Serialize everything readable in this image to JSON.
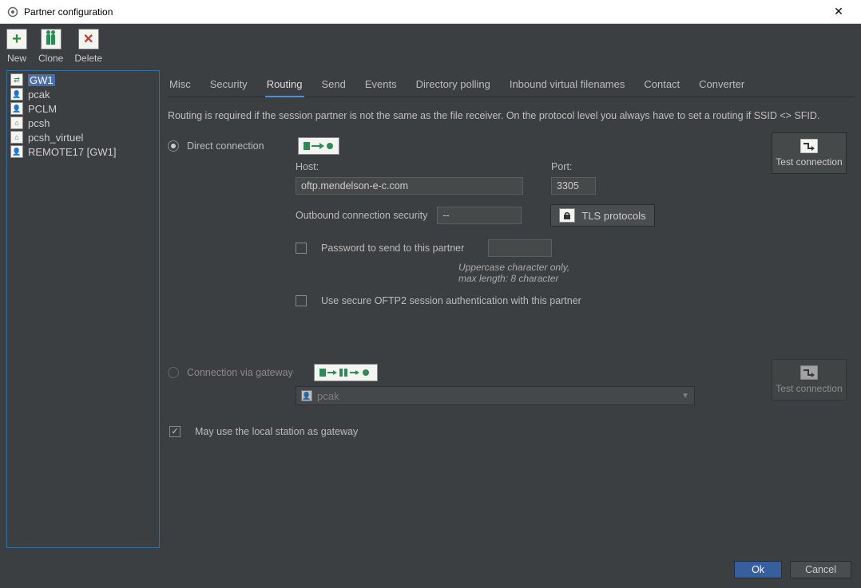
{
  "window": {
    "title": "Partner configuration"
  },
  "toolbar": {
    "new": "New",
    "clone": "Clone",
    "delete": "Delete"
  },
  "sidebar": {
    "items": [
      {
        "label": "GW1",
        "selected": true
      },
      {
        "label": "pcak"
      },
      {
        "label": "PCLM"
      },
      {
        "label": "pcsh"
      },
      {
        "label": "pcsh_virtuel"
      },
      {
        "label": "REMOTE17 [GW1]"
      }
    ]
  },
  "tabs": {
    "misc": "Misc",
    "security": "Security",
    "routing": "Routing",
    "send": "Send",
    "events": "Events",
    "dirpoll": "Directory polling",
    "inbound": "Inbound virtual filenames",
    "contact": "Contact",
    "converter": "Converter",
    "active": "routing"
  },
  "routing": {
    "info": "Routing is required if the session partner is not the same as the file receiver. On the protocol level you always have to set a routing if SSID <> SFID.",
    "direct_label": "Direct connection",
    "host_label": "Host:",
    "host_value": "oftp.mendelson-e-c.com",
    "port_label": "Port:",
    "port_value": "3305",
    "obs_label": "Outbound connection security",
    "obs_value": "--",
    "tls_button": "TLS protocols",
    "pwd_label": "Password to send to this partner",
    "pwd_value": "",
    "pwd_hint1": "Uppercase character only,",
    "pwd_hint2": "max length: 8 character",
    "secure_label": "Use secure OFTP2 session authentication with this partner",
    "test_label": "Test connection",
    "gateway_label": "Connection via gateway",
    "gateway_selected": "pcak",
    "test_label2": "Test connection",
    "local_gw_label": "May use the local station as gateway"
  },
  "footer": {
    "ok": "Ok",
    "cancel": "Cancel"
  }
}
